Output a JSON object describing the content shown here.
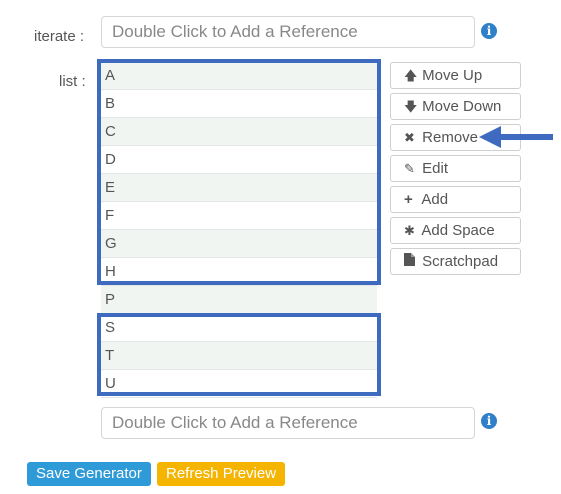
{
  "iterate": {
    "label": "iterate :",
    "placeholder": "Double Click to Add a Reference",
    "info_icon": "i"
  },
  "list": {
    "label": "list :",
    "items": [
      "A",
      "B",
      "C",
      "D",
      "E",
      "F",
      "G",
      "H",
      "P",
      "S",
      "T",
      "U"
    ]
  },
  "actions": {
    "move_up": "Move Up",
    "move_down": "Move Down",
    "remove": "Remove",
    "edit": "Edit",
    "add": "Add",
    "add_space": "Add Space",
    "scratchpad": "Scratchpad"
  },
  "bottom_reference": {
    "placeholder": "Double Click to Add a Reference",
    "info_icon": "i"
  },
  "footer": {
    "save_label": "Save Generator",
    "refresh_label": "Refresh Preview"
  },
  "colors": {
    "highlight": "#3e6bbf",
    "save_button": "#2f9ad8",
    "refresh_button": "#f5b400",
    "info_icon": "#2f80c8"
  }
}
